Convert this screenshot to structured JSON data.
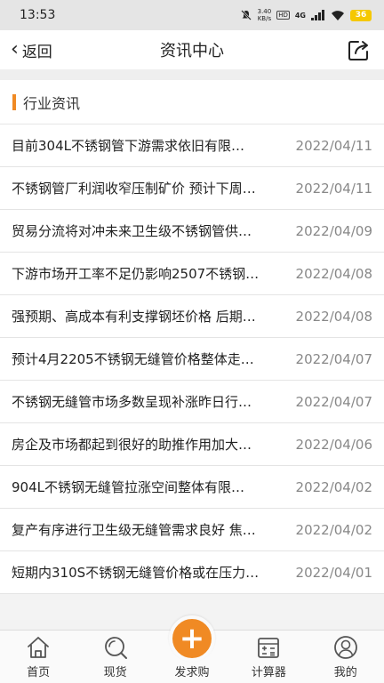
{
  "statusbar": {
    "time": "13:53",
    "net_speed_value": "3.40",
    "net_speed_unit": "KB/s",
    "hd_badge": "HD",
    "signal_label": "4G",
    "battery_level": "36"
  },
  "navbar": {
    "back_label": "返回",
    "title": "资讯中心"
  },
  "section": {
    "title": "行业资讯"
  },
  "news": [
    {
      "title": "目前304L不锈钢管下游需求依旧有限…",
      "date": "2022/04/11"
    },
    {
      "title": "不锈钢管厂利润收窄压制矿价 预计下周…",
      "date": "2022/04/11"
    },
    {
      "title": "贸易分流将对冲未来卫生级不锈钢管供…",
      "date": "2022/04/09"
    },
    {
      "title": "下游市场开工率不足仍影响2507不锈钢…",
      "date": "2022/04/08"
    },
    {
      "title": "强预期、高成本有利支撑钢坯价格 后期…",
      "date": "2022/04/08"
    },
    {
      "title": "预计4月2205不锈钢无缝管价格整体走…",
      "date": "2022/04/07"
    },
    {
      "title": "不锈钢无缝管市场多数呈现补涨昨日行…",
      "date": "2022/04/07"
    },
    {
      "title": "房企及市场都起到很好的助推作用加大…",
      "date": "2022/04/06"
    },
    {
      "title": "904L不锈钢无缝管拉涨空间整体有限…",
      "date": "2022/04/02"
    },
    {
      "title": "复产有序进行卫生级无缝管需求良好 焦…",
      "date": "2022/04/02"
    },
    {
      "title": "短期内310S不锈钢无缝管价格或在压力…",
      "date": "2022/04/01"
    }
  ],
  "tabbar": {
    "home": "首页",
    "spot": "现货",
    "post": "发求购",
    "calc": "计算器",
    "mine": "我的"
  },
  "colors": {
    "accent": "#f08a24"
  }
}
